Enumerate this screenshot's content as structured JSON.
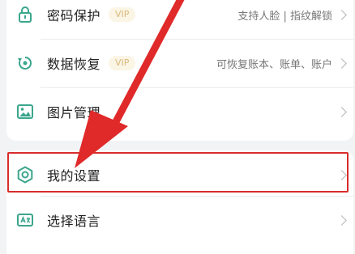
{
  "settings_rows": [
    {
      "label": "密码保护",
      "badge": "VIP",
      "description": "支持人脸 | 指纹解锁",
      "icon": "lock-icon"
    },
    {
      "label": "数据恢复",
      "badge": "VIP",
      "description": "可恢复账本、账单、账户",
      "icon": "restore-icon"
    },
    {
      "label": "图片管理",
      "icon": "image-icon"
    },
    {
      "label": "我的设置",
      "icon": "gear-icon"
    },
    {
      "label": "选择语言",
      "icon": "language-icon"
    }
  ],
  "annotation": {
    "highlight_color": "#d82c2c",
    "arrow_color": "#e02a2a"
  }
}
